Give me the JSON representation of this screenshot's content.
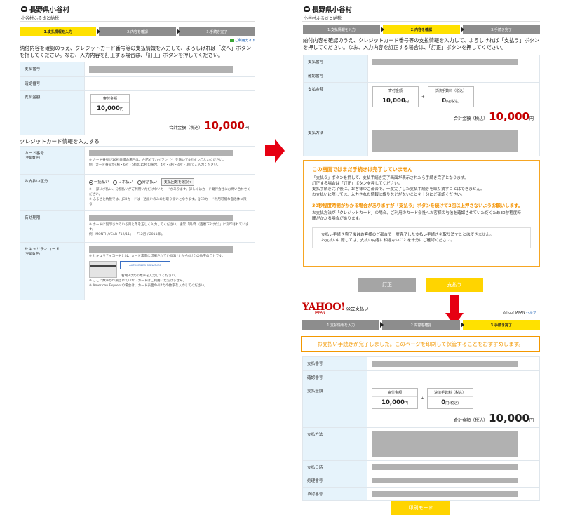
{
  "header": {
    "title": "長野県小谷村",
    "subtitle": "小谷村ふるさと納税"
  },
  "steps": [
    "1.支払情報を入力",
    "2.内容を確認",
    "3.手続き完了"
  ],
  "left": {
    "intro": "納付内容を確認のうえ、クレジットカード番号等の支払情報を入力して、よろしければ「次へ」ボタンを押してください。なお、入力内容を訂正する場合は、「訂正」ボタンを押してください。",
    "guide_link": "ご利用ガイド",
    "rows": {
      "pay_no": "支払番号",
      "confirm_no": "確認番号",
      "amount": "支払金額"
    },
    "kifu_label": "寄付金額",
    "kifu_value": "10,000",
    "yen": "円",
    "total_label": "合計金額（税込）",
    "total_value": "10,000",
    "cc_heading": "クレジットカード情報を入力する",
    "card_no_label": "カード番号",
    "half_width": "(半角数字)",
    "card_note1": "※ カード番号が16桁未満の場合は、左詰めでハイフン（-）を除いて4桁ずつご入力ください。",
    "card_note2": "例）カード番号が4桁・6桁・5桁の15桁の場合、4桁・4桁・4桁・3桁でご入力ください。",
    "pay_type_label": "お支払い区分",
    "pay_opt1": "一括払い",
    "pay_opt2": "リボ払い",
    "pay_opt3": "分割払い",
    "pay_select": "支払回数を選択",
    "pay_note1": "※ 一部リボ払い、分割払いがご利用いただけないカードがあります。詳しくはカード発行会社にお問い合わせください。",
    "pay_note2": "※ ふるさと納税では、JCBカードは一括払いのみのお取り扱いとなります。（JCBカード利用可能な自治体に限る）",
    "expiry_label": "有効期限",
    "expiry_note1": "※ カードに刻印されている月と年を正しく入力してください。通常「月/年（西暦下2けた）」に刻印されています。",
    "expiry_note2": "例）MONTH/YEAR「12/11」→「12月 / 2011年」。",
    "sec_label": "セキュリティコード",
    "sec_note1": "※ セキュリティコードとは、カード裏面に印刷されている3けたから4けたの数字のことです。",
    "card_img_text": "AUTHORIZED SIGNATURE",
    "card_img_caption": "右端3けたの数字を入力してください。",
    "sec_note2": "※ ここに数字が印刷されていないカードはご利用いただけません。",
    "sec_note3": "※ American Expressの場合は、カード表面の4けたの数字を入力してください。"
  },
  "right_top": {
    "intro": "納付内容を確認のうえ、クレジットカード番号等の支払情報を入力して、よろしければ「支払う」ボタンを押してください。なお、入力内容を訂正する場合は、「訂正」ボタンを押してください。",
    "rows": {
      "pay_no": "支払番号",
      "confirm_no": "確認番号",
      "amount": "支払金額",
      "method": "支払方法"
    },
    "kifu_label": "寄付金額",
    "kifu_value": "10,000",
    "fee_label": "決済手数料（税込）",
    "fee_value": "0",
    "fee_unit": "円(税込)",
    "yen": "円",
    "plus": "+",
    "total_label": "合計金額（税込）",
    "total_value": "10,000",
    "warn_title": "この画面ではまだ手続きは完了していません",
    "warn_lines": [
      "「支払う」ボタンを押して、支払手続き完了画面が表示されたら手続き完了となります。",
      "訂正する場合は「訂正」ボタンを押してください。",
      "支払手続き完了後に、お客様のご都合で、一度完了した支払手続きを取り消すことはできません。",
      "お支払いに際しては、入力された情報に誤りなどがないことを十分にご確認ください。"
    ],
    "warn2_title": "30秒程度時間がかかる場合がありますが「支払う」ボタンを続けて2回以上押さないようお願いします。",
    "warn2_lines": [
      "お支払方法が「クレジットカード」の場合、ご利用のカード会社へお客様の与信を確認させていただくため30秒程度時",
      "間がかかる場合があります。"
    ],
    "inner_lines": [
      "支払い手続き完了後はお客様のご都合で一度完了した支払い手続きを取り消すことはできません。",
      "お支払いに際しては、支払い内容に相違ないことを十分にご確認ください。"
    ],
    "btn_fix": "訂正",
    "btn_pay": "支払う"
  },
  "right_bottom": {
    "yahoo_logo": "YAHOO!",
    "yahoo_japan": "JAPAN",
    "service": "公金支払い",
    "top_link": "Yahoo! JAPAN",
    "help_link": "ヘルプ",
    "complete_msg": "お支払い手続きが完了しました。このページを印刷して保管することをおすすめします。",
    "rows": {
      "pay_no": "支払番号",
      "confirm_no": "確認番号",
      "amount": "支払金額",
      "method": "支払方法",
      "date": "支払日時",
      "proc_no": "処理番号",
      "accept_no": "承認番号"
    },
    "kifu_label": "寄付金額",
    "kifu_value": "10,000",
    "fee_label": "決済手数料（税込）",
    "fee_value": "0",
    "fee_unit": "円(税込)",
    "yen": "円",
    "plus": "+",
    "total_label": "合計金額（税込）",
    "total_value": "10,000",
    "print_btn": "印刷モード"
  },
  "colors": {
    "step_active": "#ffe100",
    "label_bg": "#e6f3fb",
    "total_red": "#c40000",
    "warn_orange": "#f39200",
    "arrow_red": "#e60012"
  }
}
